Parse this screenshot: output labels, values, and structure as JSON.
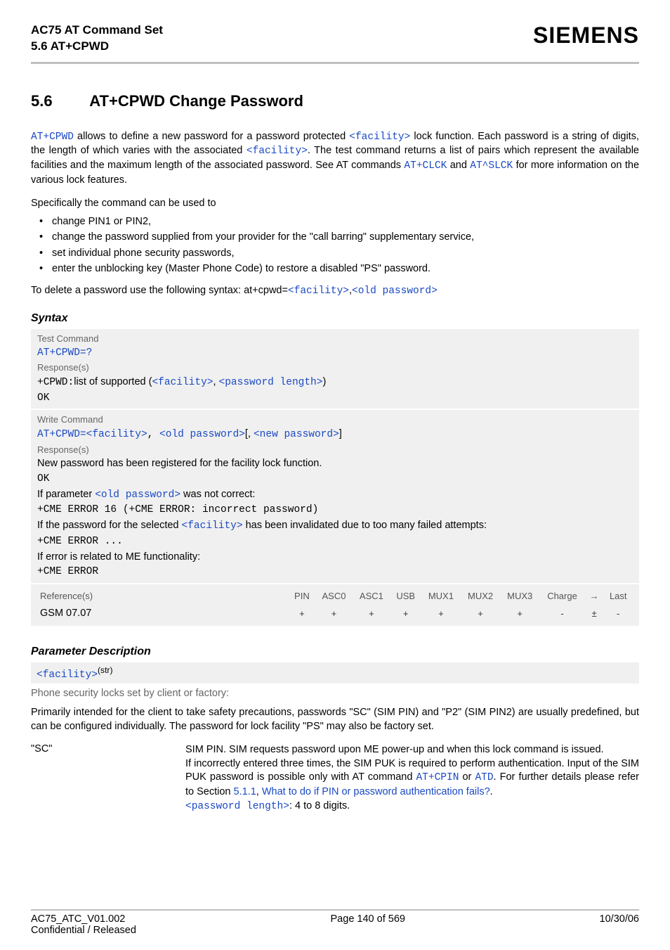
{
  "header": {
    "title_line1": "AC75 AT Command Set",
    "title_line2": "5.6 AT+CPWD",
    "brand": "SIEMENS"
  },
  "section": {
    "number": "5.6",
    "title": "AT+CPWD   Change Password"
  },
  "intro": {
    "cmd_link": "AT+CPWD",
    "t1a": " allows to define a new password for a password protected ",
    "facility_link": "<facility>",
    "t1b": " lock function. Each password is a string of digits, the length of which varies with the associated ",
    "t1c": ". The test command returns a list of pairs which represent the available facilities and the maximum length of the associated password. See AT commands ",
    "atclck": "AT+CLCK",
    "t1d": " and ",
    "atslck": "AT^SLCK",
    "t1e": " for more information on the various lock features.",
    "spec_lead": "Specifically the command can be used to",
    "bullets": [
      "change PIN1 or PIN2,",
      "change the password supplied from your provider for the \"call barring\" supplementary service,",
      "set individual phone security passwords,",
      "enter the unblocking key (Master Phone Code) to restore a disabled \"PS\" password."
    ],
    "del_a": "To delete a password use the following syntax: at+cpwd=",
    "del_fac": "<facility>",
    "del_comma": ",",
    "del_old": "<old password>"
  },
  "syntax": {
    "heading": "Syntax",
    "test_label": "Test Command",
    "test_cmd": "AT+CPWD=?",
    "resp_label": "Response(s)",
    "test_resp_prefix": "+CPWD:",
    "test_resp_mid": "list of supported (",
    "test_resp_fac": "<facility>",
    "test_resp_sep": ", ",
    "test_resp_len": "<password length>",
    "test_resp_suffix": ")",
    "ok": "OK",
    "write_label": "Write Command",
    "write_cmd_prefix": "AT+CPWD=",
    "write_fac": "<facility>",
    "write_sep1": ", ",
    "write_old": "<old password>",
    "write_opt_open": "[, ",
    "write_new": "<new password>",
    "write_opt_close": "]",
    "wr1": "New password has been registered for the facility lock function.",
    "wr2a": "If parameter ",
    "wr2b": "<old password>",
    "wr2c": " was not correct:",
    "wr3": "+CME ERROR 16 (+CME ERROR: incorrect password)",
    "wr4a": "If the password for the selected ",
    "wr4b": "<facility>",
    "wr4c": " has been invalidated due to too many failed attempts:",
    "wr5": "+CME ERROR ...",
    "wr6": "If error is related to ME functionality:",
    "wr7": "+CME ERROR"
  },
  "reftable": {
    "ref_label": "Reference(s)",
    "cols": [
      "PIN",
      "ASC0",
      "ASC1",
      "USB",
      "MUX1",
      "MUX2",
      "MUX3",
      "Charge",
      "→",
      "Last"
    ],
    "row_label": "GSM 07.07",
    "row": [
      "+",
      "+",
      "+",
      "+",
      "+",
      "+",
      "+",
      "-",
      "±",
      "-"
    ]
  },
  "paramdesc": {
    "heading": "Parameter Description",
    "facility": "<facility>",
    "sup": "(str)",
    "subhead": "Phone security locks set by client or factory:",
    "p1": "Primarily intended for the client to take safety precautions, passwords \"SC\" (SIM PIN) and \"P2\" (SIM PIN2) are usually predefined, but can be configured individually. The password for lock facility \"PS\" may also be factory set.",
    "sc_key": "\"SC\"",
    "sc_a": "SIM PIN. SIM requests password upon ME power-up and when this lock command is issued.",
    "sc_b1": "If incorrectly entered three times, the SIM PUK is required to perform authentication. Input of the SIM PUK password is possible only with AT command ",
    "sc_atcpin": "AT+CPIN",
    "sc_or": " or ",
    "sc_atd": "ATD",
    "sc_b2": ". For further details please refer to Section ",
    "sc_secnum": "5.1.1",
    "sc_comma": ", ",
    "sc_sectitle": "What to do if PIN or password authentication fails?",
    "sc_dot": ".",
    "sc_len_link": "<password length>",
    "sc_len_txt": ": 4 to 8 digits."
  },
  "footer": {
    "left1": "AC75_ATC_V01.002",
    "left2": "Confidential / Released",
    "center": "Page 140 of 569",
    "right": "10/30/06"
  }
}
